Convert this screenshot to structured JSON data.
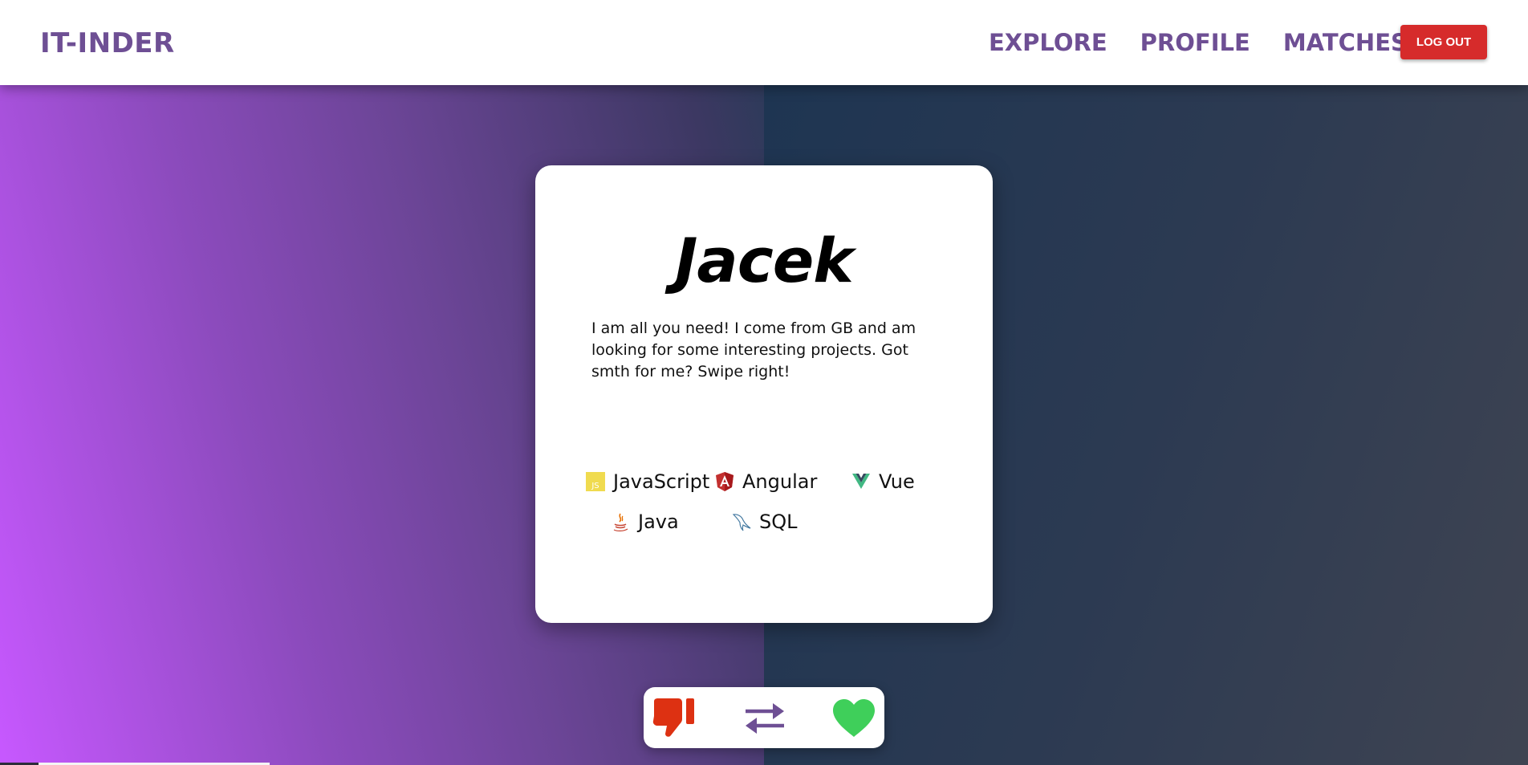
{
  "app": {
    "brand": "IT-INDER"
  },
  "nav": {
    "links": [
      "EXPLORE",
      "PROFILE",
      "MATCHES"
    ],
    "logout_label": "LOG OUT"
  },
  "profile": {
    "name": "Jacek",
    "bio": "I am all you need! I come from GB and am looking for some interesting projects. Got smth for me? Swipe right!",
    "skills": [
      {
        "label": "JavaScript",
        "icon": "javascript-icon"
      },
      {
        "label": "Angular",
        "icon": "angular-icon"
      },
      {
        "label": "Vue",
        "icon": "vue-icon"
      },
      {
        "label": "Java",
        "icon": "java-icon"
      },
      {
        "label": "SQL",
        "icon": "sql-icon"
      }
    ]
  },
  "actions": {
    "icons": [
      "thumbs-down-icon",
      "swap-icon",
      "heart-icon"
    ]
  },
  "colors": {
    "brand": "#6e4f94",
    "logout": "#d62b2b",
    "dislike": "#dd3112",
    "like": "#3fcf5a"
  }
}
